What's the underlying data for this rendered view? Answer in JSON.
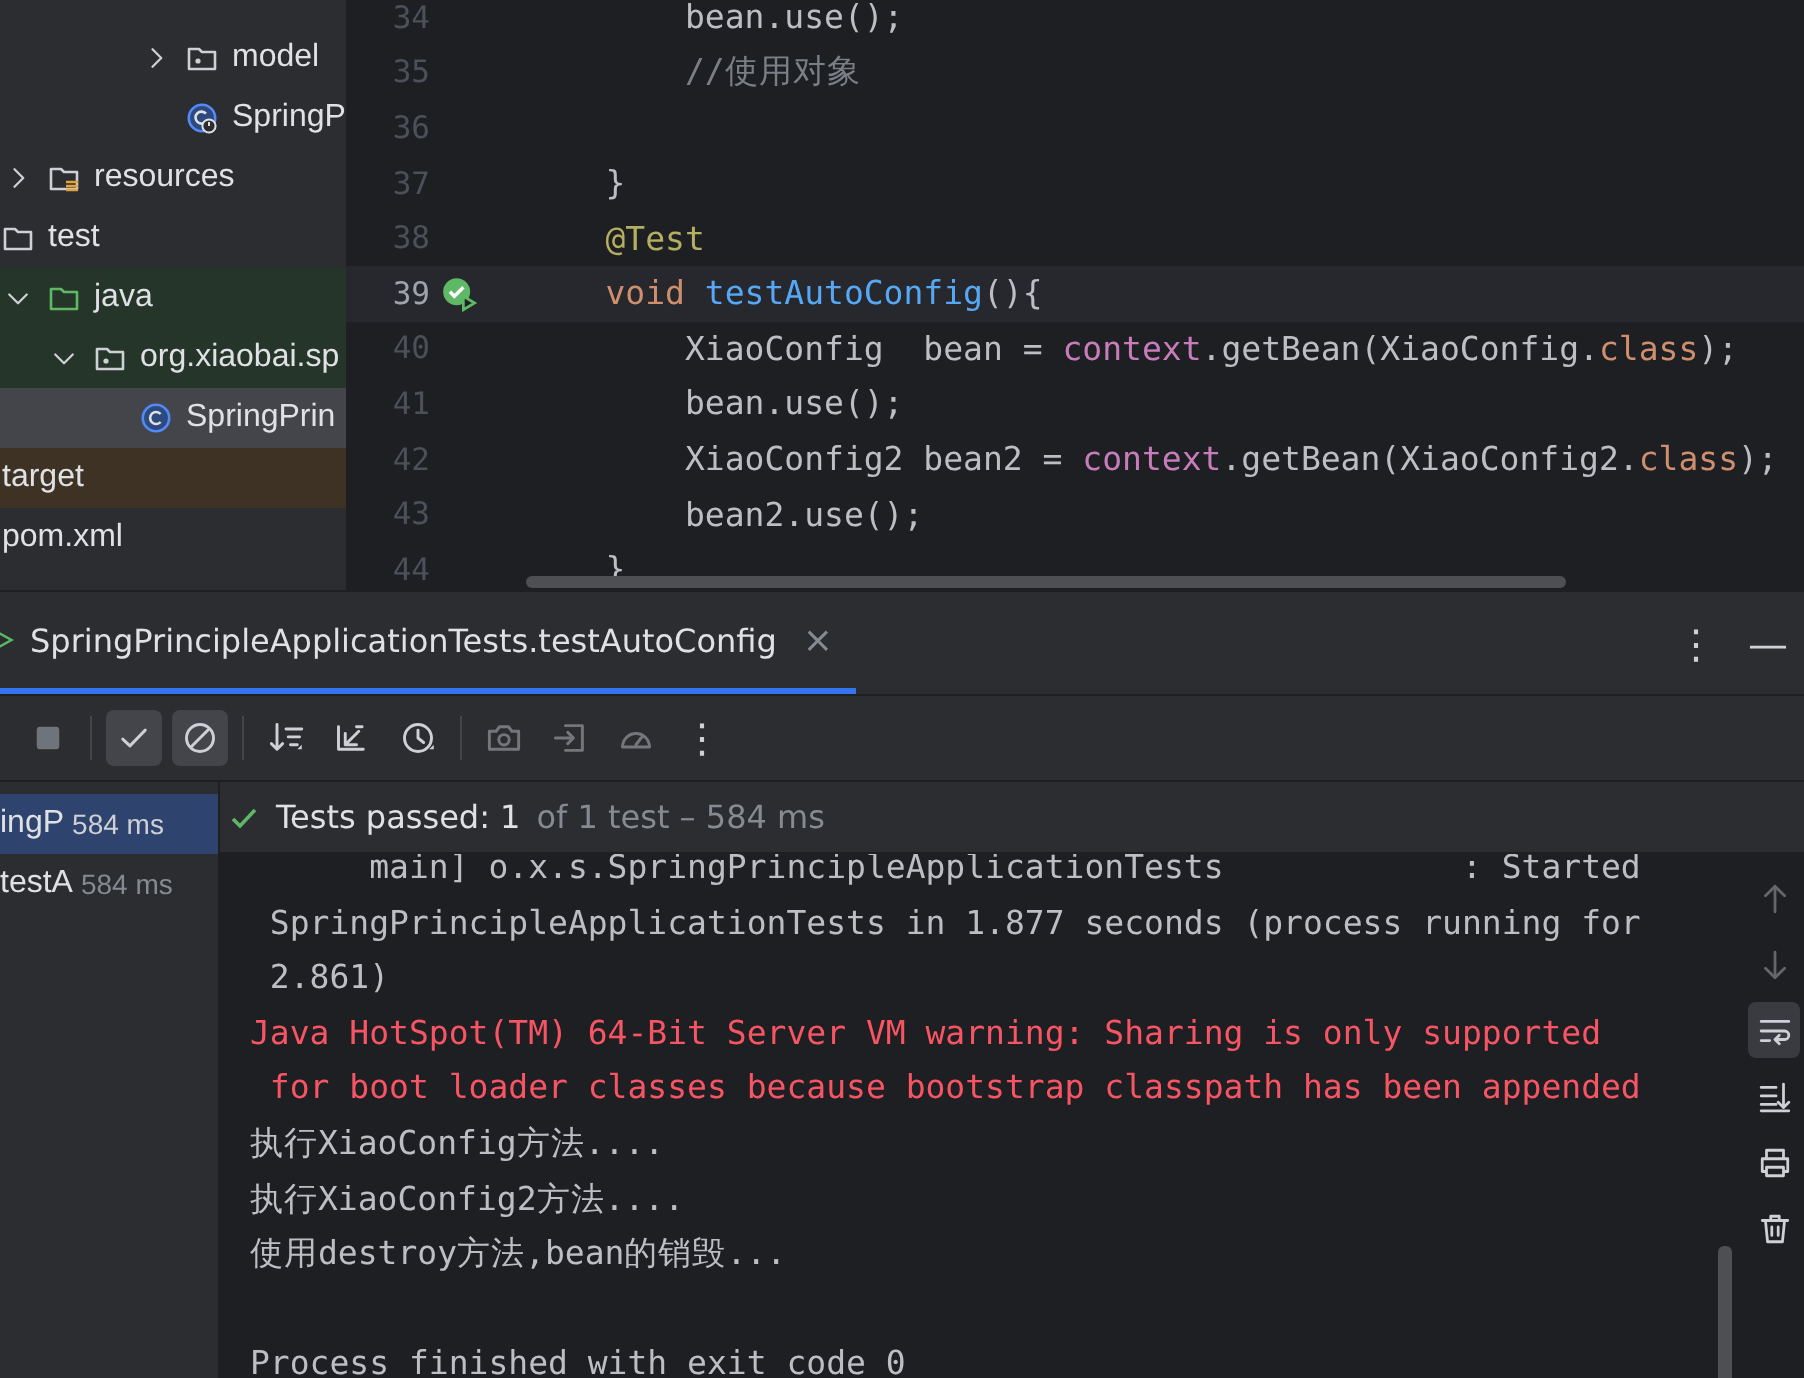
{
  "project_tree": {
    "items": [
      {
        "children": [
          {
            "children": [
              {
                "children": [
                  {
                    "children": [
                      {
                        "children": [
                          {
                            "label": "model",
                            "kind": "package",
                            "expanded": false,
                            "selected": false
                          },
                          {
                            "label": "SpringP",
                            "kind": "boot-class",
                            "selected": false
                          }
                        ]
                      }
                    ]
                  }
                ]
              },
              {
                "label": "resources",
                "kind": "resources",
                "expanded": false,
                "selected": false
              }
            ]
          },
          {
            "label": "test",
            "kind": "folder",
            "selected": false,
            "children": [
              {
                "label": "java",
                "kind": "test-root",
                "expanded": true,
                "selected": false,
                "color": "#26352a",
                "children": [
                  {
                    "label": "org.xiaobai.sp",
                    "kind": "package",
                    "expanded": true,
                    "selected": false,
                    "color": "#26352a",
                    "children": [
                      {
                        "label": "SpringPrin",
                        "kind": "class",
                        "selected": true
                      }
                    ]
                  }
                ]
              }
            ]
          }
        ]
      },
      {
        "label": "target",
        "selected": false,
        "color": "#3d3223"
      },
      {
        "label": "pom.xml",
        "selected": false
      }
    ]
  },
  "editor": {
    "lines": [
      {
        "number": "34",
        "current": false,
        "tokens": [
          {
            "kind": "plain",
            "text": "        bean.use();"
          }
        ]
      },
      {
        "number": "35",
        "current": false,
        "tokens": [
          {
            "kind": "comment",
            "text": "        //使用对象"
          }
        ]
      },
      {
        "number": "36",
        "current": false
      },
      {
        "number": "37",
        "current": false,
        "tokens": [
          {
            "kind": "plain",
            "text": "    }"
          }
        ]
      },
      {
        "number": "38",
        "current": false,
        "tokens": [
          {
            "kind": "annotation",
            "text": "    @Test"
          }
        ]
      },
      {
        "number": "39",
        "current": true,
        "test_passed": true,
        "tokens": [
          {
            "kind": "keyword",
            "text": "    void "
          },
          {
            "kind": "method",
            "text": "testAutoConfig"
          },
          {
            "kind": "plain",
            "text": "(){"
          }
        ]
      },
      {
        "number": "40",
        "current": false,
        "tokens": [
          {
            "kind": "plain",
            "text": "        XiaoConfig  bean = "
          },
          {
            "kind": "field",
            "text": "context"
          },
          {
            "kind": "plain",
            "text": ".getBean(XiaoConfig."
          },
          {
            "kind": "keyword",
            "text": "class"
          },
          {
            "kind": "plain",
            "text": ");"
          }
        ]
      },
      {
        "number": "41",
        "current": false,
        "tokens": [
          {
            "kind": "plain",
            "text": "        bean.use();"
          }
        ]
      },
      {
        "number": "42",
        "current": false,
        "tokens": [
          {
            "kind": "plain",
            "text": "        XiaoConfig2 bean2 = "
          },
          {
            "kind": "field",
            "text": "context"
          },
          {
            "kind": "plain",
            "text": ".getBean(XiaoConfig2."
          },
          {
            "kind": "keyword",
            "text": "class"
          },
          {
            "kind": "plain",
            "text": ");"
          }
        ]
      },
      {
        "number": "43",
        "current": false,
        "tokens": [
          {
            "kind": "plain",
            "text": "        bean2.use();"
          }
        ]
      },
      {
        "number": "44",
        "current": false,
        "tokens": [
          {
            "kind": "plain",
            "text": "    }"
          }
        ]
      }
    ]
  },
  "run_panel": {
    "tabs": [
      {
        "label": "SpringPrincipleApplicationTests.testAutoConfig",
        "selected": true,
        "close": "×"
      }
    ],
    "more": "⋮",
    "minimize": "—",
    "toolbar": [
      {
        "kind": "stop",
        "disabled": false
      },
      {
        "kind": "separator"
      },
      {
        "kind": "show-passed",
        "disabled": false,
        "selected": true
      },
      {
        "kind": "show-ignored",
        "disabled": false,
        "selected": true
      },
      {
        "kind": "separator"
      },
      {
        "kind": "sort",
        "disabled": false
      },
      {
        "kind": "collapse",
        "disabled": false
      },
      {
        "kind": "history",
        "disabled": false
      },
      {
        "kind": "separator"
      },
      {
        "kind": "camera",
        "disabled": true
      },
      {
        "kind": "import",
        "disabled": true
      },
      {
        "kind": "gauge",
        "disabled": true
      },
      {
        "kind": "more",
        "disabled": false,
        "label": "⋮"
      }
    ],
    "test_tree": [
      {
        "label": "ingP",
        "time": "584 ms",
        "selected": true
      },
      {
        "label": "testA",
        "time": "584 ms",
        "selected": false
      }
    ],
    "status": {
      "passed": true,
      "summary": "Tests passed: 1",
      "detail": "of 1 test – 584 ms"
    },
    "console": [
      {
        "kind": "stdout",
        "text": "      main] o.x.s.SpringPrincipleApplicationTests            : Started"
      },
      {
        "kind": "stdout",
        "text": " SpringPrincipleApplicationTests in 1.877 seconds (process running for"
      },
      {
        "kind": "stdout",
        "text": " 2.861)"
      },
      {
        "kind": "stderr",
        "text": "Java HotSpot(TM) 64-Bit Server VM warning: Sharing is only supported"
      },
      {
        "kind": "stderr",
        "text": " for boot loader classes because bootstrap classpath has been appended"
      },
      {
        "kind": "stdout",
        "text": "执行XiaoConfig方法...."
      },
      {
        "kind": "stdout",
        "text": "执行XiaoConfig2方法...."
      },
      {
        "kind": "stdout",
        "text": "使用destroy方法,bean的销毁..."
      },
      {
        "kind": "blank"
      },
      {
        "kind": "stdout",
        "text": "Process finished with exit code 0"
      }
    ],
    "console_actions": [
      {
        "kind": "up",
        "selected": false,
        "disabled": true
      },
      {
        "kind": "down",
        "selected": false,
        "disabled": true
      },
      {
        "kind": "wrap",
        "selected": true,
        "disabled": false
      },
      {
        "kind": "scroll-end",
        "selected": false,
        "disabled": false
      },
      {
        "kind": "print",
        "selected": false,
        "disabled": false
      },
      {
        "kind": "trash",
        "selected": false,
        "disabled": false
      }
    ]
  }
}
